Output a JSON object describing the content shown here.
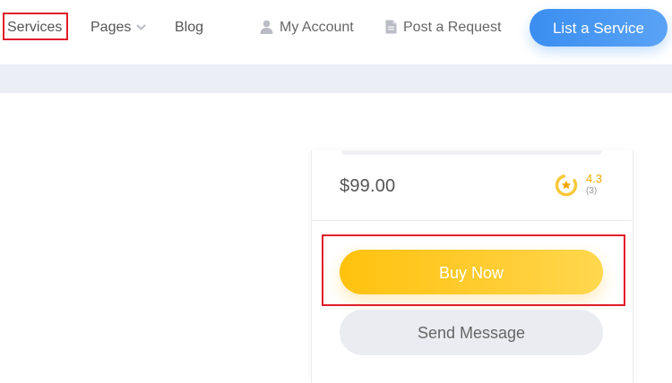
{
  "nav": {
    "services": "Services",
    "pages": "Pages",
    "blog": "Blog",
    "my_account": "My Account",
    "post_request": "Post a Request",
    "cta": "List a Service"
  },
  "listing": {
    "price": "$99.00",
    "rating": "4.3",
    "rating_count": "(3)",
    "buy_label": "Buy Now",
    "message_label": "Send Message"
  },
  "colors": {
    "accent_blue": "#3a8ef0",
    "accent_yellow": "#ffc20e",
    "rating_color": "#f2a900",
    "highlight_red": "#e11d2a"
  },
  "icons": {
    "pages_chevron": "chevron-down-icon",
    "account": "user-icon",
    "request": "document-icon",
    "rating": "star-ring-icon"
  }
}
